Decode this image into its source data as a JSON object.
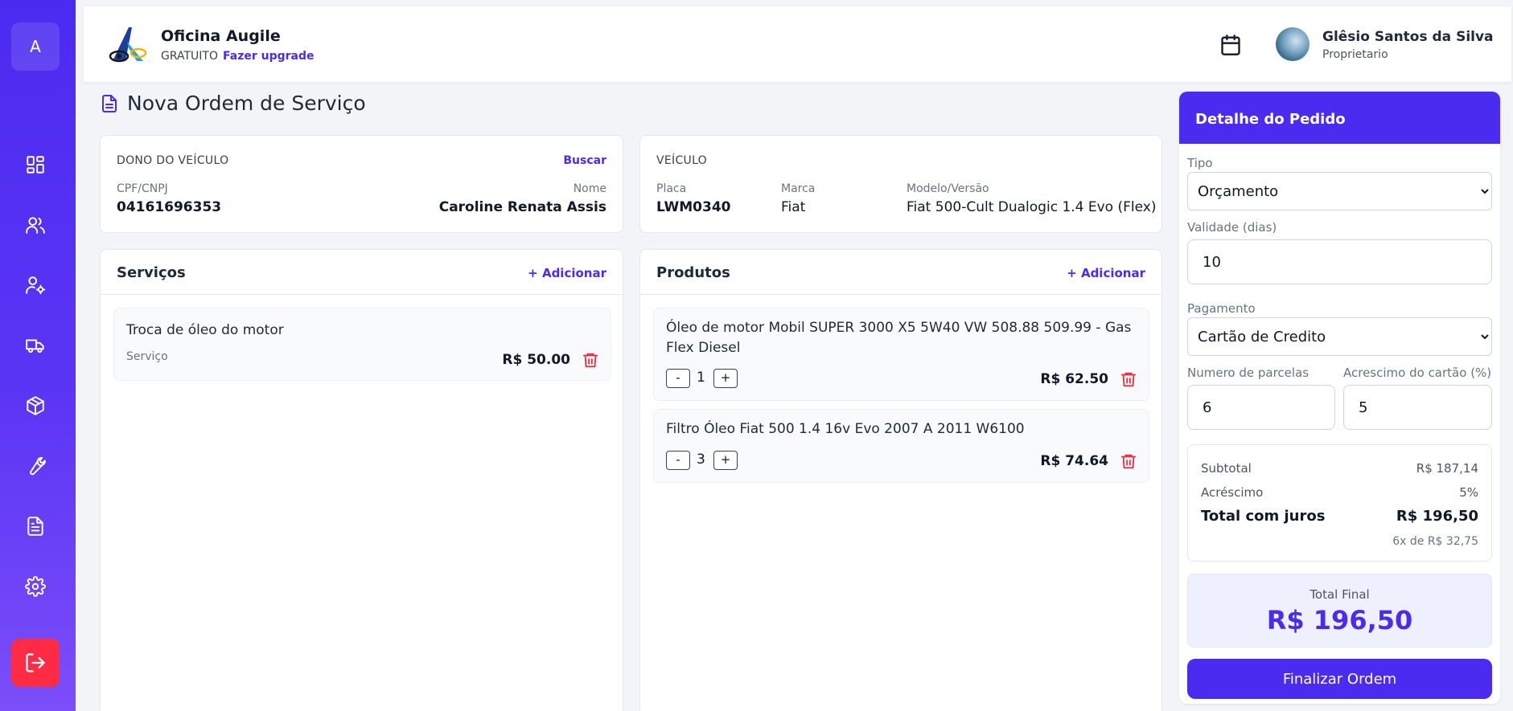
{
  "sidebar": {
    "avatar_letter": "A",
    "items": [
      {
        "icon": "dashboard-icon"
      },
      {
        "icon": "users-icon"
      },
      {
        "icon": "user-gear-icon"
      },
      {
        "icon": "truck-icon"
      },
      {
        "icon": "box-icon"
      },
      {
        "icon": "wrench-icon"
      },
      {
        "icon": "document-icon"
      },
      {
        "icon": "gear-icon"
      }
    ],
    "logout_icon": "logout-icon"
  },
  "header": {
    "brand_name": "Oficina Augile",
    "plan": "GRATUITO",
    "upgrade": "Fazer upgrade",
    "user_name": "Glêsio Santos da Silva",
    "user_role": "Proprietario"
  },
  "page": {
    "title": "Nova Ordem de Serviço"
  },
  "owner": {
    "label": "DONO DO VEÍCULO",
    "search": "Buscar",
    "doc_label": "CPF/CNPJ",
    "doc_value": "04161696353",
    "name_label": "Nome",
    "name_value": "Caroline Renata Assis"
  },
  "vehicle": {
    "label": "VEÍCULO",
    "plate_label": "Placa",
    "plate_value": "LWM0340",
    "brand_label": "Marca",
    "brand_value": "Fiat",
    "model_label": "Modelo/Versão",
    "model_value": "Fiat 500-Cult Dualogic 1.4 Evo (Flex)"
  },
  "services": {
    "title": "Serviços",
    "add": "+ Adicionar",
    "items": [
      {
        "name": "Troca de óleo do motor",
        "type": "Serviço",
        "price": "R$ 50.00"
      }
    ]
  },
  "products": {
    "title": "Produtos",
    "add": "+ Adicionar",
    "minus": "-",
    "plus": "+",
    "items": [
      {
        "name": "Óleo de motor Mobil SUPER 3000 X5 5W40 VW 508.88 509.99 - Gas Flex Diesel",
        "qty": "1",
        "price": "R$ 62.50"
      },
      {
        "name": "Filtro Óleo Fiat 500 1.4 16v Evo 2007 A 2011 W6100",
        "qty": "3",
        "price": "R$ 74.64"
      }
    ]
  },
  "order": {
    "title": "Detalhe do Pedido",
    "type_label": "Tipo",
    "type_value": "Orçamento",
    "validity_label": "Validade (dias)",
    "validity_value": "10",
    "payment_label": "Pagamento",
    "payment_value": "Cartão de Credito",
    "installments_label": "Numero de parcelas",
    "installments_value": "6",
    "card_fee_label": "Acrescimo do cartão (%)",
    "card_fee_value": "5",
    "subtotal_label": "Subtotal",
    "subtotal_value": "R$ 187,14",
    "surcharge_label": "Acréscimo",
    "surcharge_value": "5%",
    "total_interest_label": "Total com juros",
    "total_interest_value": "R$ 196,50",
    "installment_text": "6x de R$ 32,75",
    "final_label": "Total Final",
    "final_value": "R$ 196,50",
    "finish_button": "Finalizar Ordem"
  },
  "colors": {
    "accent": "#4a2bef",
    "danger": "#ef2b3d",
    "logout": "#ff2b45"
  }
}
